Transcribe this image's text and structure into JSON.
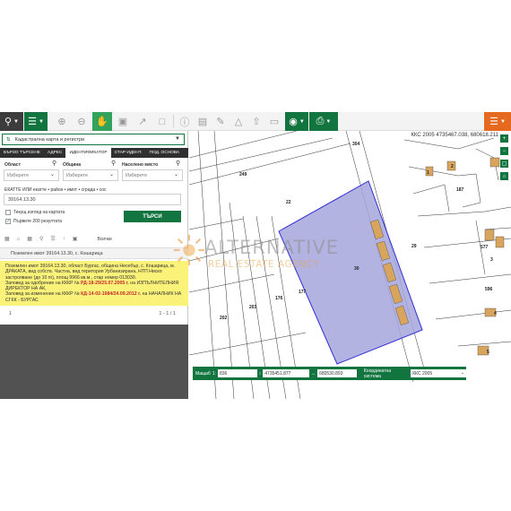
{
  "toolbar": {
    "icons": [
      "search-icon",
      "layers-icon",
      "zoom-in-icon",
      "zoom-out-icon",
      "pan-hand-icon",
      "map-view-icon",
      "export-icon",
      "bookmark-icon",
      "info-icon",
      "ruler-icon",
      "area-icon",
      "upload-icon",
      "folder-icon",
      "location-icon",
      "print-icon",
      "menu-icon"
    ]
  },
  "panel": {
    "layer_select": "Кадастрална карта и регистри",
    "tabs": [
      "БЪРЗО ТЪРСЕНЕ",
      "АДРЕС",
      "ИДЕНТИФИКАТОР",
      "СТАР ИДЕНТ.",
      "ПОД. ОСНОВА"
    ],
    "active_tab_index": 2,
    "fields": {
      "oblast_label": "Област",
      "obshtina_label": "Община",
      "naseleno_label": "Населено място",
      "placeholder": "Изберете",
      "identifier_label": "ЕКАТТЕ ИЛИ екатте • район • имот • сграда • сос",
      "identifier_value": "39164.13.30"
    },
    "checkbox_current_view": "Текущ изглед на картата",
    "checkbox_first_200": "Първите 200 резултата",
    "search_button": "ТЪРСИ",
    "all_label": "Всички",
    "result_title": "Поземлен имот 39164.13.30, с. Кошарица",
    "result_text": "Поземлен имот 39164.13.30, област Бургас, община Несебър, с. Кошарица, м. ДРАКАТА, вид собств. Частна, вид територия Урбанизирана, НТП Ниско застрояване (до 10 m), площ 9966 кв.м., стар номер 013030.",
    "result_order1_prefix": "Заповед за одобрение на КККР №",
    "result_order1_link": "РД-18-29/25.07.2005 г.",
    "result_order1_suffix": "на ИЗПЪЛНИТЕЛНИЯ ДИРЕКТОР НА АК,",
    "result_order2_prefix": "Заповед за изменение на КККР №",
    "result_order2_link": "КД-14-02-1684/24.09.2012 г.",
    "result_order2_suffix": "на НАЧАЛНИК НА СГКК - БУРГАС",
    "pager_left": "1",
    "pager_right": "1 - 1 / 1"
  },
  "map": {
    "coord_readout": "ККС 2005 4735467.038, 680618.211",
    "parcel_labels": [
      "304",
      "249",
      "22",
      "30",
      "29",
      "176",
      "177",
      "203",
      "202",
      "187",
      "1",
      "2",
      "577",
      "596",
      "3",
      "4",
      "5"
    ],
    "coord_bar": {
      "scale_label": "Мащаб",
      "scale_value": "836",
      "x_value": "4735451.877",
      "y_value": "680530.893",
      "system_label": "Координатна система",
      "system_value": "ККС 2005"
    }
  },
  "watermark": {
    "title": "ALTERNATIVE",
    "subtitle": "REAL ESTATE AGENCY"
  },
  "colors": {
    "brand_green": "#12753f",
    "highlight_yellow": "#fbf27a",
    "parcel_fill": "#a6a6dd",
    "parcel_border": "#2f2fd6",
    "building_fill": "#d9a55c",
    "accent_orange": "#e56a1f"
  }
}
